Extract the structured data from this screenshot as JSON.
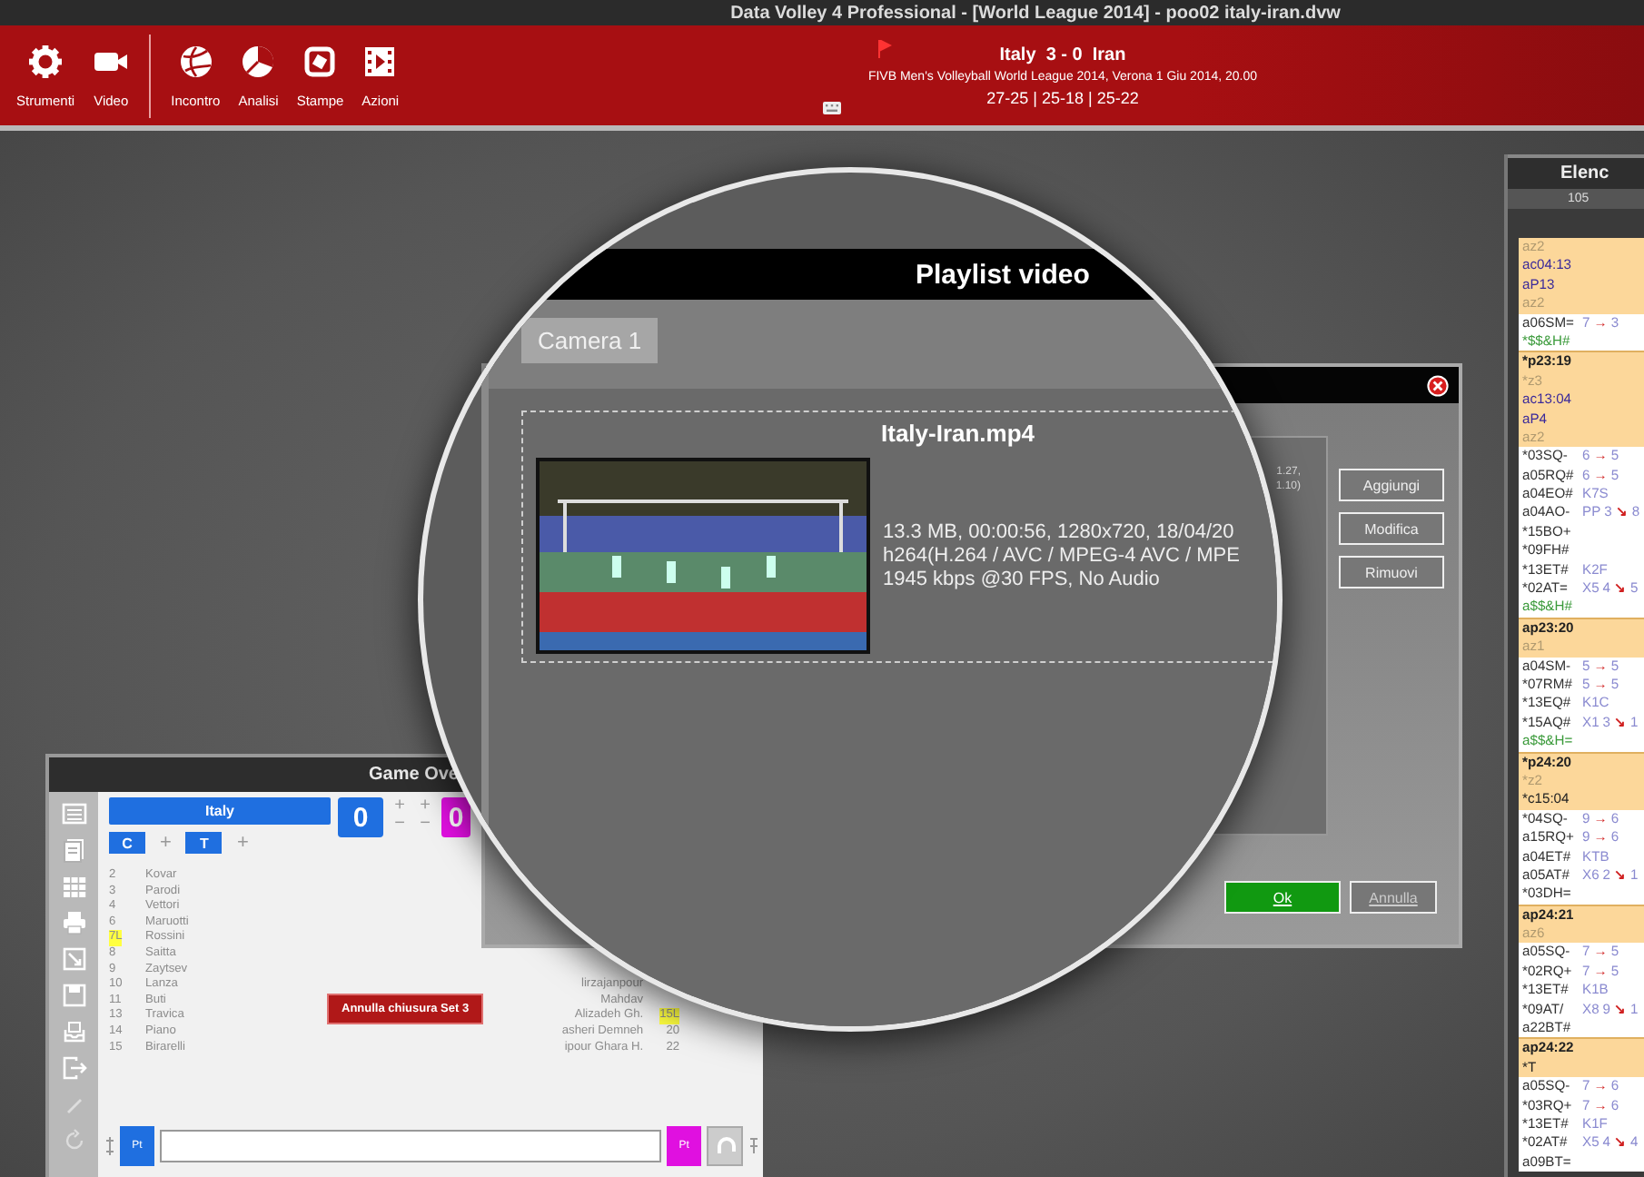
{
  "window": {
    "title": "Data Volley 4 Professional - [World League 2014] - poo02 italy-iran.dvw"
  },
  "toolbar": {
    "groups": [
      [
        "Strumenti",
        "Video"
      ],
      [
        "Incontro",
        "Analisi",
        "Stampe",
        "Azioni"
      ]
    ]
  },
  "match": {
    "home": "Italy",
    "result": "3 - 0",
    "away": "Iran",
    "event": "FIVB Men's Volleyball World League 2014, Verona 1 Giu 2014, 20.00",
    "sets": "27-25 | 25-18 | 25-22"
  },
  "code_list": {
    "title": "Elenc",
    "subtitle": "105",
    "rows": [
      {
        "kind": "zone",
        "code": "az2"
      },
      {
        "kind": "time",
        "code": "ac04:13"
      },
      {
        "kind": "time",
        "code": "aP13"
      },
      {
        "kind": "zone",
        "code": "az2"
      },
      {
        "kind": "code",
        "code": "a06SM=",
        "from": "7",
        "to": "3",
        "arrow": "→"
      },
      {
        "kind": "combo",
        "code": "*$$&H#"
      },
      {
        "kind": "point",
        "code": "*p23:19"
      },
      {
        "kind": "zone",
        "code": "*z3"
      },
      {
        "kind": "time",
        "code": "ac13:04"
      },
      {
        "kind": "time",
        "code": "aP4"
      },
      {
        "kind": "zone",
        "code": "az2"
      },
      {
        "kind": "code",
        "code": "*03SQ-",
        "from": "6",
        "to": "5",
        "arrow": "→"
      },
      {
        "kind": "code",
        "code": "a05RQ#",
        "from": "6",
        "to": "5",
        "arrow": "→"
      },
      {
        "kind": "code",
        "code": "a04EO#",
        "extra": "K7S"
      },
      {
        "kind": "code",
        "code": "a04AO-",
        "extra": "PP",
        "from": "3",
        "to": "8",
        "arrow": "↘"
      },
      {
        "kind": "code",
        "code": "*15BO+"
      },
      {
        "kind": "code",
        "code": "*09FH#"
      },
      {
        "kind": "code",
        "code": "*13ET#",
        "extra": "K2F"
      },
      {
        "kind": "code",
        "code": "*02AT=",
        "extra": "X5",
        "from": "4",
        "to": "5",
        "arrow": "↘"
      },
      {
        "kind": "combo",
        "code": "a$$&H#"
      },
      {
        "kind": "point",
        "code": "ap23:20"
      },
      {
        "kind": "zone",
        "code": "az1"
      },
      {
        "kind": "code",
        "code": "a04SM-",
        "from": "5",
        "to": "5",
        "arrow": "→"
      },
      {
        "kind": "code",
        "code": "*07RM#",
        "from": "5",
        "to": "5",
        "arrow": "→"
      },
      {
        "kind": "code",
        "code": "*13EQ#",
        "extra": "K1C"
      },
      {
        "kind": "code",
        "code": "*15AQ#",
        "extra": "X1",
        "from": "3",
        "to": "1",
        "arrow": "↘"
      },
      {
        "kind": "combo",
        "code": "a$$&H="
      },
      {
        "kind": "point",
        "code": "*p24:20"
      },
      {
        "kind": "zone",
        "code": "*z2"
      },
      {
        "kind": "marker",
        "code": "*c15:04"
      },
      {
        "kind": "code",
        "code": "*04SQ-",
        "from": "9",
        "to": "6",
        "arrow": "→"
      },
      {
        "kind": "code",
        "code": "a15RQ+",
        "from": "9",
        "to": "6",
        "arrow": "→"
      },
      {
        "kind": "code",
        "code": "a04ET#",
        "extra": "KTB"
      },
      {
        "kind": "code",
        "code": "a05AT#",
        "extra": "X6",
        "from": "2",
        "to": "1",
        "arrow": "↘"
      },
      {
        "kind": "code",
        "code": "*03DH="
      },
      {
        "kind": "point",
        "code": "ap24:21"
      },
      {
        "kind": "zone",
        "code": "az6"
      },
      {
        "kind": "code",
        "code": "a05SQ-",
        "from": "7",
        "to": "5",
        "arrow": "→"
      },
      {
        "kind": "code",
        "code": "*02RQ+",
        "from": "7",
        "to": "5",
        "arrow": "→"
      },
      {
        "kind": "code",
        "code": "*13ET#",
        "extra": "K1B"
      },
      {
        "kind": "code",
        "code": "*09AT/",
        "extra": "X8",
        "from": "9",
        "to": "1",
        "arrow": "↘"
      },
      {
        "kind": "code",
        "code": "a22BT#"
      },
      {
        "kind": "point",
        "code": "ap24:22"
      },
      {
        "kind": "marker",
        "code": "*T"
      },
      {
        "kind": "code",
        "code": "a05SQ-",
        "from": "7",
        "to": "6",
        "arrow": "→"
      },
      {
        "kind": "code",
        "code": "*03RQ+",
        "from": "7",
        "to": "6",
        "arrow": "→"
      },
      {
        "kind": "code",
        "code": "*13ET#",
        "extra": "K1F"
      },
      {
        "kind": "code",
        "code": "*02AT#",
        "extra": "X5",
        "from": "4",
        "to": "4",
        "arrow": "↘"
      },
      {
        "kind": "code",
        "code": "a09BT="
      }
    ]
  },
  "game_overview": {
    "title": "Game Ove",
    "team": "Italy",
    "score": "0",
    "opponent_score": "0",
    "tags": [
      "C",
      "T"
    ],
    "players": [
      {
        "number": "2",
        "name": "Kovar",
        "libero": false
      },
      {
        "number": "3",
        "name": "Parodi",
        "libero": false
      },
      {
        "number": "4",
        "name": "Vettori",
        "libero": false
      },
      {
        "number": "6",
        "name": "Maruotti",
        "libero": false
      },
      {
        "number": "7L",
        "name": "Rossini",
        "libero": true
      },
      {
        "number": "8",
        "name": "Saitta",
        "libero": false
      },
      {
        "number": "9",
        "name": "Zaytsev",
        "libero": false
      },
      {
        "number": "10",
        "name": "Lanza",
        "libero": false
      },
      {
        "number": "11",
        "name": "Buti",
        "libero": false
      },
      {
        "number": "13",
        "name": "Travica",
        "libero": false
      },
      {
        "number": "14",
        "name": "Piano",
        "libero": false
      },
      {
        "number": "15",
        "name": "Birarelli",
        "libero": false
      }
    ],
    "opponents": [
      {
        "name": "lirzajanpour"
      },
      {
        "name": "Mahdav"
      },
      {
        "name": "Alizadeh Gh.",
        "number": "15L",
        "libero": true
      },
      {
        "name": "asheri Demneh",
        "number": "20",
        "libero": false
      },
      {
        "name": "ipour Ghara H.",
        "number": "22",
        "libero": false
      }
    ],
    "score_controls": [
      "+",
      "−"
    ],
    "add_label": "+",
    "undo_button": "Annulla chiusura Set 3",
    "point_buttons": [
      "Pt",
      "Pt"
    ]
  },
  "video_dialog": {
    "notes": [
      "1.27,",
      "1.10)"
    ],
    "side_buttons": [
      "Aggiungi",
      "Modifica",
      "Rimuovi"
    ],
    "ok": "Ok",
    "cancel": "Annulla"
  },
  "playlist": {
    "title": "Playlist video",
    "tabs": [
      {
        "label": "Camera 1",
        "selected": true
      }
    ],
    "file": {
      "name": "Italy-Iran.mp4",
      "details": [
        "13.3 MB, 00:00:56, 1280x720, 18/04/20",
        "h264(H.264 / AVC / MPEG-4 AVC / MPE",
        "1945 kbps @30 FPS, No Audio"
      ]
    }
  }
}
